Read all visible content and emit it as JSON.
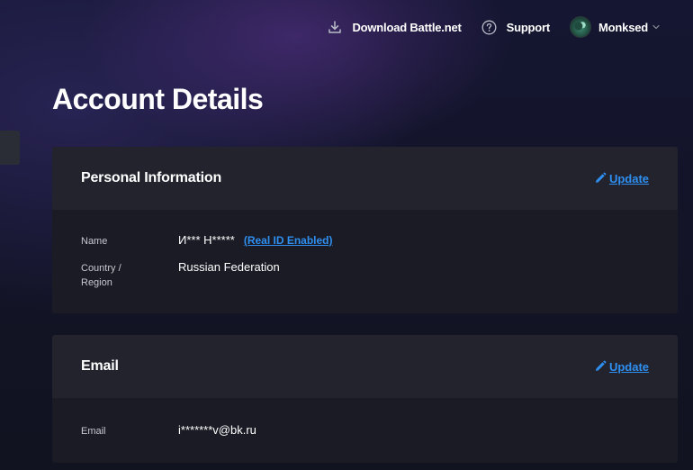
{
  "topnav": {
    "download_label": "Download Battle.net",
    "support_label": "Support",
    "username": "Monksed"
  },
  "page": {
    "title": "Account Details"
  },
  "personal": {
    "title": "Personal Information",
    "update_label": "Update",
    "name_label": "Name",
    "name_value": "И*** Н*****",
    "real_id_link": "(Real ID Enabled)",
    "country_label_line1": "Country /",
    "country_label_line2": "Region",
    "country_value": "Russian Federation"
  },
  "email": {
    "title": "Email",
    "update_label": "Update",
    "email_label": "Email",
    "email_value": "i*******v@bk.ru"
  },
  "colors": {
    "link": "#2f8ff1",
    "card_bg": "#1a1b24",
    "card_header_bg": "#22232d",
    "page_bg": "#131429"
  },
  "icons": {
    "download": "download-icon",
    "support": "help-circle-icon",
    "user": "avatar",
    "caret": "chevron-down-icon",
    "edit": "pencil-icon"
  }
}
